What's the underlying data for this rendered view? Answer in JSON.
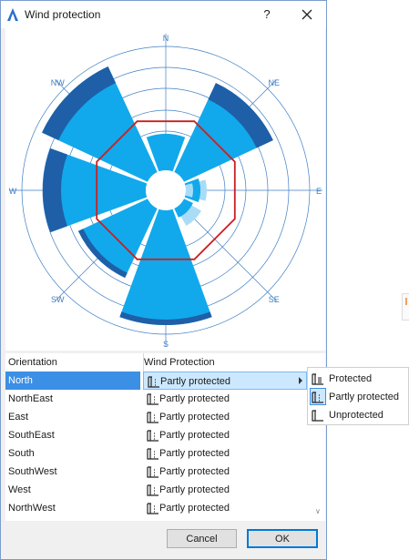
{
  "window": {
    "title": "Wind protection",
    "help_label": "?"
  },
  "icons": {
    "app": "archicad-icon",
    "close": "close-icon",
    "help": "help-icon"
  },
  "colors": {
    "sector_dark": "#1f5fa8",
    "sector_mid": "#11a9ec",
    "sector_light": "#a8dcf7",
    "polygon": "#cc1f1f",
    "selection": "#3b8fe5"
  },
  "compass": {
    "n": "N",
    "ne": "NE",
    "e": "E",
    "se": "SE",
    "s": "S",
    "sw": "SW",
    "w": "W",
    "nw": "NW"
  },
  "table": {
    "headers": {
      "orientation": "Orientation",
      "wind_protection": "Wind Protection"
    },
    "rows": [
      {
        "orientation": "North",
        "protection": "Partly protected"
      },
      {
        "orientation": "NorthEast",
        "protection": "Partly protected"
      },
      {
        "orientation": "East",
        "protection": "Partly protected"
      },
      {
        "orientation": "SouthEast",
        "protection": "Partly protected"
      },
      {
        "orientation": "South",
        "protection": "Partly protected"
      },
      {
        "orientation": "SouthWest",
        "protection": "Partly protected"
      },
      {
        "orientation": "West",
        "protection": "Partly protected"
      },
      {
        "orientation": "NorthWest",
        "protection": "Partly protected"
      }
    ],
    "selected_row": "North"
  },
  "menu": {
    "items": [
      "Protected",
      "Partly protected",
      "Unprotected"
    ],
    "selected": "Partly protected"
  },
  "buttons": {
    "cancel": "Cancel",
    "ok": "OK"
  }
}
